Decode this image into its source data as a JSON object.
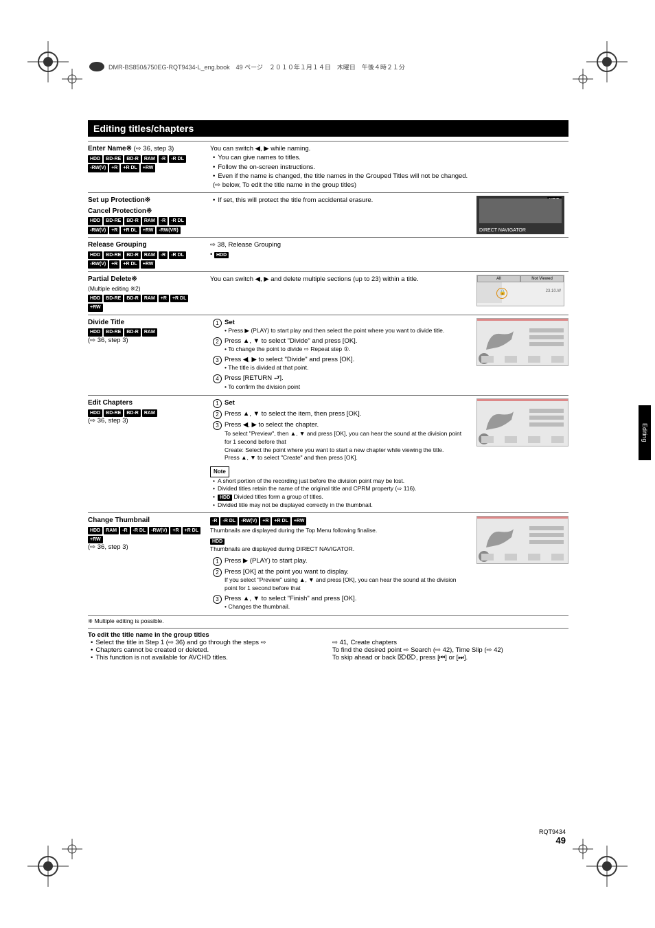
{
  "header_trail": "DMR-BS850&750EG-RQT9434-L_eng.book　49 ページ　２０１０年１月１４日　木曜日　午後４時２１分",
  "title": "Editing titles/chapters",
  "rows": {
    "enter_name": {
      "heading": "Enter Name※",
      "arrow_note": "(⇨ 36, step 3)",
      "badges": [
        "HDD",
        "BD-RE",
        "BD-R",
        "RAM",
        "-R",
        "-R DL",
        "-RW(V)",
        "+R",
        "+R DL",
        "+RW"
      ],
      "mid_line1": "You can switch ◀, ▶ while naming.",
      "bul1": "You can give names to titles.",
      "bul2": "Follow the on-screen instructions.",
      "bul3": "Even if the name is changed, the title names in the Grouped Titles will not be changed. (⇨ below, To edit the title name in the group titles)"
    },
    "set_protection": {
      "heading": "Set up Protection※",
      "heading2": "Cancel Protection※",
      "badges": [
        "HDD",
        "BD-RE",
        "BD-R",
        "RAM",
        "-R",
        "-R DL",
        "-RW(V)",
        "+R",
        "+R DL",
        "+RW",
        "-RW(VR)"
      ],
      "bul1": "If set, this will protect the title from accidental erasure.",
      "panel_label_top": "HDD",
      "panel_label_bottom": "DIRECT NAVIGATOR"
    },
    "release_group": {
      "heading": "Release Grouping",
      "badges": [
        "HDD",
        "BD-RE",
        "BD-R",
        "RAM",
        "-R",
        "-R DL",
        "-RW(V)",
        "+R",
        "+R DL",
        "+RW"
      ],
      "line1": "⇨ 38, Release Grouping",
      "hdd_badge": "HDD"
    },
    "partial_delete": {
      "heading": "Partial Delete※",
      "sub": "(Multiple editing ※2)",
      "badges": [
        "HDD",
        "BD-RE",
        "BD-R",
        "RAM",
        "+R",
        "+R DL",
        "+RW"
      ],
      "line1": "You can switch ◀, ▶ and delete multiple sections (up to 23) within a title.",
      "tab_all": "All",
      "tab_not": "Not Viewed",
      "date": "23.10.W"
    },
    "divide_title": {
      "heading": "Divide Title",
      "badges": [
        "HDD",
        "BD-RE",
        "BD-R",
        "RAM"
      ],
      "arrow_note": "(⇨ 36, step 3)",
      "s1": "Set",
      "s1b": "Press ▶ (PLAY) to start play and then select the point where you want to divide title.",
      "s2": "Press ▲, ▼ to select \"Divide\" and press [OK].",
      "s2b": "To change the point to divide ⇨ Repeat step ①.",
      "s3": "Press ◀, ▶ to select \"Divide\" and press [OK].",
      "s3b": "The title is divided at that point.",
      "s4": "Press [RETURN ⮐].",
      "s4b": "To confirm the division point"
    },
    "edit_chapters": {
      "heading": "Edit Chapters",
      "badges": [
        "HDD",
        "BD-RE",
        "BD-R",
        "RAM"
      ],
      "arrow_note": "(⇨ 36, step 3)",
      "s1": "Set",
      "s2": "Press ▲, ▼ to select the item, then press [OK].",
      "s3": "Press ◀, ▶ to select the chapter.",
      "sub1": "To select \"Preview\", then ▲, ▼ and press [OK], you can hear the sound at the division point for 1 second before that",
      "sub2": "Create:    Select the point where you want to start a new chapter while viewing the title.",
      "sub2b": "Press ▲, ▼ to select \"Create\" and then press [OK].",
      "note_label": "Note",
      "n1": "A short portion of the recording just before the division point may be lost.",
      "n2": "Divided titles retain the name of the original title and CPRM property (⇨ 116).",
      "n3_badge": "HDD",
      "n3": "Divided titles form a group of titles.",
      "n4": "Divided title may not be displayed correctly in the thumbnail."
    },
    "change_thumb": {
      "heading": "Change Thumbnail",
      "badges": [
        "HDD",
        "RAM",
        "-R",
        "-R DL",
        "-RW(V)",
        "+R",
        "+R DL",
        "+RW"
      ],
      "arrow_note": "(⇨ 36, step 3)",
      "top_badges": [
        "-R",
        "-R DL",
        "-RW(V)",
        "+R",
        "+R DL",
        "+RW"
      ],
      "top_text": "Thumbnails are displayed during the Top Menu following finalise.",
      "hdd_badge": "HDD",
      "hdd_text": "Thumbnails are displayed during DIRECT NAVIGATOR.",
      "s1": "Press ▶ (PLAY) to start play.",
      "s2": "Press [OK] at the point you want to display.",
      "sub": "If you select \"Preview\" using ▲, ▼ and press [OK], you can hear the sound at the division point for 1 second before that",
      "s3": "Press ▲, ▼ to select \"Finish\" and press [OK].",
      "s3b": "Changes the thumbnail."
    }
  },
  "footnote_star": "※ Multiple editing is possible.",
  "footer": {
    "h": "To edit the title name in the group titles",
    "l1": "Select the title in Step 1 (⇨ 36) and go through the steps ⇨",
    "l2": "Chapters cannot be created or deleted.",
    "l3": "This function is not available for AVCHD titles.",
    "r1": "⇨ 41, Create chapters",
    "r2": "To find the desired point ⇨ Search (⇨ 42), Time Slip (⇨ 42)",
    "r3": "To skip ahead or back ⌦⌦, press [⏮] or [⏭]."
  },
  "side_tab": "Editing",
  "page": {
    "code": "RQT9434",
    "num": "49"
  }
}
